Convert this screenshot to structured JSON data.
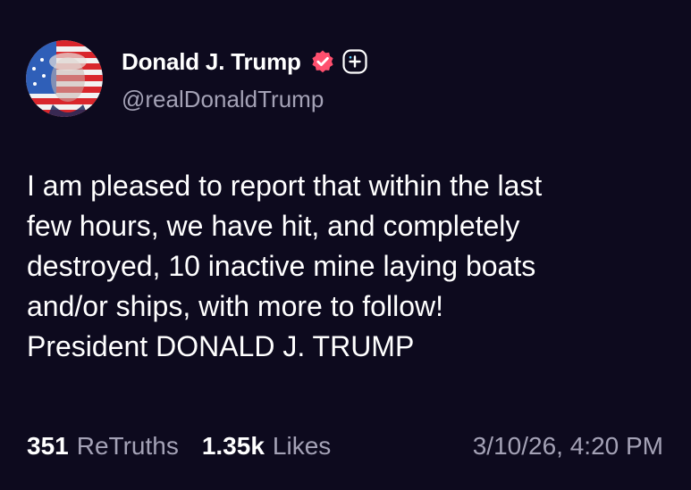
{
  "author": {
    "display_name": "Donald J. Trump",
    "handle": "@realDonaldTrump",
    "avatar_icon": "flag-portrait-avatar",
    "verified_icon": "verified-badge-icon",
    "verified_color": "#ff4f6e",
    "plus_icon": "plus-badge-icon"
  },
  "post": {
    "text": "I am pleased to report that within the last\nfew hours, we have hit, and completely\ndestroyed, 10 inactive mine laying boats\nand/or ships, with more to follow!\nPresident DONALD J. TRUMP"
  },
  "stats": {
    "retruths_count": "351",
    "retruths_label": "ReTruths",
    "likes_count": "1.35k",
    "likes_label": "Likes",
    "timestamp": "3/10/26, 4:20 PM"
  },
  "colors": {
    "background": "#0d0a1e",
    "text_primary": "#ffffff",
    "text_secondary": "#a4a2b6"
  }
}
